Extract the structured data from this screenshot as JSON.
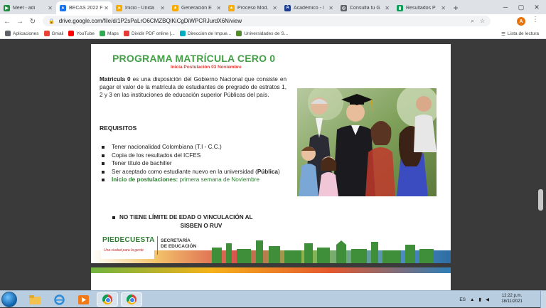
{
  "browser": {
    "tabs": [
      {
        "title": "Meet - adi",
        "color": "#1e8e3e",
        "glyph": "▶",
        "active": false
      },
      {
        "title": "BECAS 2022 P",
        "color": "#1a73e8",
        "glyph": "▲",
        "active": true
      },
      {
        "title": "Inicio - Unida",
        "color": "#f9ab00",
        "glyph": "▲",
        "active": false
      },
      {
        "title": "Generación E",
        "color": "#f9ab00",
        "glyph": "▲",
        "active": false
      },
      {
        "title": "Proceso Mod.",
        "color": "#f9ab00",
        "glyph": "▲",
        "active": false
      },
      {
        "title": "Académico - /",
        "color": "#1a3d8f",
        "glyph": "A",
        "active": false
      },
      {
        "title": "Consulta tu G",
        "color": "#5f6368",
        "glyph": "◎",
        "active": false
      },
      {
        "title": "Resultados P",
        "color": "#0f9d58",
        "glyph": "▮",
        "active": false
      }
    ],
    "new_tab_label": "+",
    "url": "drive.google.com/file/d/1P2sPaLrO6CMZBQlKiCgDiWPCRJurdX6N/view",
    "profile_initial": "A",
    "bookmarks": [
      {
        "label": "Aplicaciones",
        "color": "#5f6368"
      },
      {
        "label": "Gmail",
        "color": "#ea4335"
      },
      {
        "label": "YouTube",
        "color": "#ff0000"
      },
      {
        "label": "Maps",
        "color": "#34a853"
      },
      {
        "label": "Dividir PDF online |...",
        "color": "#e53935"
      },
      {
        "label": "Dirección de Impue...",
        "color": "#00acc1"
      },
      {
        "label": "Universidades de S...",
        "color": "#558b2f"
      }
    ],
    "reading_list": "Lista de lectura"
  },
  "slide": {
    "title": "PROGRAMA MATRÍCULA CERO  0",
    "subtitle": "Inicia Postulación 03 Noviembre",
    "intro_bold": "Matricula 0",
    "intro_text": " es una disposición del Gobierno Nacional que consiste en pagar el valor de la matrícula de estudiantes de pregrado de estratos 1, 2 y 3 en las instituciones de educación superior Públicas del país.",
    "requirements_heading": "REQUISITOS",
    "requirements": [
      {
        "text": "Tener nacionalidad Colombiana (T.I - C.C.)",
        "bold": "",
        "after": "",
        "green": false
      },
      {
        "text": "Copia de los resultados del ICFES",
        "bold": "",
        "after": "",
        "green": false
      },
      {
        "text": "Tener título de bachiller",
        "bold": "",
        "after": "",
        "green": false
      },
      {
        "text": "Ser aceptado como estudiante nuevo en la universidad (",
        "bold": "Pública",
        "after": ")",
        "green": false
      },
      {
        "text": "",
        "bold": "Inicio de postulaciones:",
        "after": " primera semana de Noviembre",
        "green": true
      }
    ],
    "note_line1": "NO TIENE LÍMITE DE EDAD O VINCULACIÓN AL",
    "note_line2": "SISBEN O RUV",
    "logo_name": "PIEDECUESTA",
    "logo_tagline": "Una ciudad para la gente",
    "secretaria_line1": "SECRETARÍA",
    "secretaria_line2": "DE EDUCACIÓN"
  },
  "taskbar": {
    "clock_time": "12:22 p.m.",
    "clock_date": "18/11/2021",
    "language": "ES"
  }
}
